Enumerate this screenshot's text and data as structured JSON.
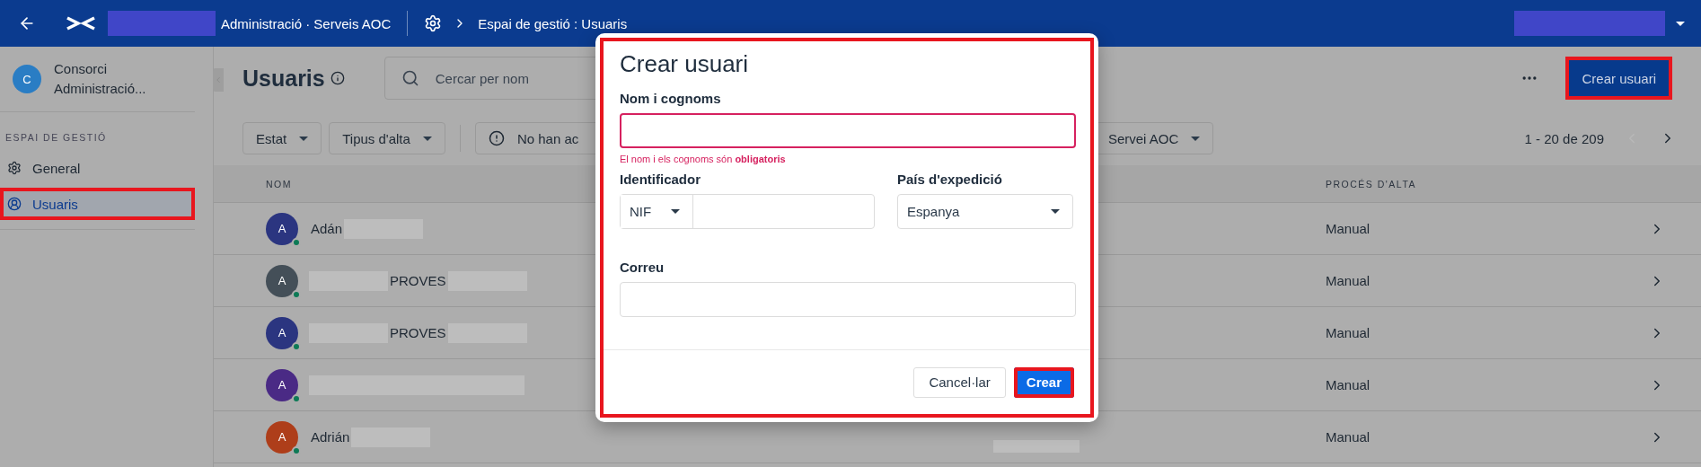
{
  "header": {
    "app_name": "Administració · Serveis AOC",
    "breadcrumb": "Espai de gestió : Usuaris"
  },
  "sidebar": {
    "org_initial": "C",
    "org_name": "Consorci Administració...",
    "section_label": "ESPAI DE GESTIÓ",
    "items": [
      {
        "kind": "gear",
        "label": "General",
        "selected": false,
        "highlighted": false
      },
      {
        "kind": "user",
        "label": "Usuaris",
        "selected": true,
        "highlighted": true
      }
    ]
  },
  "page": {
    "title": "Usuaris",
    "search": {
      "placeholder": "Cercar per nom"
    },
    "create_button": {
      "label": "Crear usuari",
      "highlighted": true
    },
    "filters": [
      {
        "kind": "dropdown",
        "label": "Estat"
      },
      {
        "kind": "dropdown",
        "label": "Tipus d'alta"
      },
      {
        "kind": "alert",
        "label": "No han ac"
      }
    ],
    "service_filter": "Servei AOC",
    "pagination": {
      "range": "1 - 20 de 209",
      "prev_disabled": true
    }
  },
  "table": {
    "columns": [
      "NOM",
      "PROCÉS D'ALTA"
    ],
    "rows": [
      {
        "initial": "A",
        "color": "#2b3580",
        "name": [
          {
            "kind": "text",
            "text": "Adán"
          },
          {
            "kind": "redacted"
          }
        ],
        "column_3_redacted": false,
        "process": "Manual"
      },
      {
        "initial": "A",
        "color": "#444f58",
        "name": [
          {
            "kind": "redacted"
          },
          {
            "kind": "text",
            "text": "PROVES"
          },
          {
            "kind": "redacted"
          }
        ],
        "column_3_redacted": false,
        "process": "Manual"
      },
      {
        "initial": "A",
        "color": "#2b3580",
        "name": [
          {
            "kind": "redacted"
          },
          {
            "kind": "text",
            "text": "PROVES"
          },
          {
            "kind": "redacted"
          }
        ],
        "column_3_redacted": false,
        "process": "Manual"
      },
      {
        "initial": "A",
        "color": "#4a2a85",
        "name": [
          {
            "kind": "redacted"
          }
        ],
        "column_3_redacted": false,
        "process": "Manual"
      },
      {
        "initial": "A",
        "color": "#ae3e1a",
        "name": [
          {
            "kind": "text",
            "text": "Adrián"
          },
          {
            "kind": "redacted"
          }
        ],
        "column_3_redacted": true,
        "process": "Manual"
      }
    ]
  },
  "modal": {
    "title": "Crear usuari",
    "highlighted": true,
    "name_field": {
      "label": "Nom i cognoms",
      "invalid": true,
      "error": "El nom i els cognoms són **obligatoris**"
    },
    "id_field": {
      "label": "Identificador",
      "type": "NIF"
    },
    "country_field": {
      "label": "País d'expedició",
      "value": "Espanya"
    },
    "email_field": {
      "label": "Correu"
    },
    "buttons": [
      {
        "kind": "secondary",
        "label": "Cancel·lar",
        "highlighted": false
      },
      {
        "kind": "primary",
        "label": "Crear",
        "highlighted": true
      }
    ]
  }
}
